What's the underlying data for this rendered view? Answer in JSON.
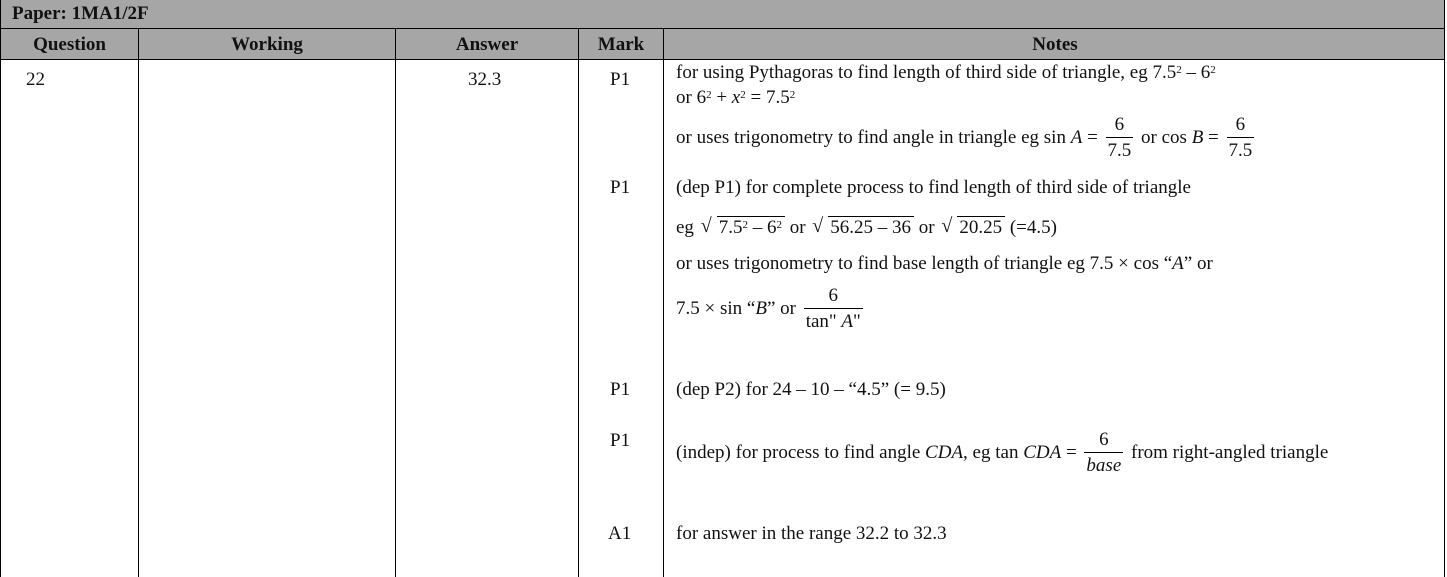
{
  "paper": {
    "title": "Paper: 1MA1/2F"
  },
  "headers": {
    "question": "Question",
    "working": "Working",
    "answer": "Answer",
    "mark": "Mark",
    "notes": "Notes"
  },
  "row": {
    "question": "22",
    "answer": "32.3"
  },
  "marks": [
    "P1",
    "P1",
    "P1",
    "P1",
    "A1"
  ],
  "notes": {
    "n1_a": "for using Pythagoras to find length of third side of triangle, eg  7.5",
    "n1_b": " – 6",
    "n1_c": "or 6",
    "n1_d": " + ",
    "n1_e": "x",
    "n1_f": " = 7.5",
    "sup2": "2",
    "n2_a": "or uses trigonometry to find angle in triangle eg sin ",
    "n2_A": "A",
    "n2_eq": " = ",
    "n2_num": "6",
    "n2_den": "7.5",
    "n2_or": " or cos ",
    "n2_B": "B",
    "n3": "(dep P1) for complete process to find length of third side of triangle",
    "n4_eg": "eg ",
    "n4_r1a": "7.5",
    "n4_r1b": " – 6",
    "n4_or1": "   or ",
    "n4_r2": "56.25 – 36",
    "n4_or2": "   or ",
    "n4_r3": "20.25",
    "n4_res": "  (=4.5)",
    "n5_a": "or uses trigonometry to find base length of triangle eg 7.5 × cos “",
    "n5_A": "A",
    "n5_b": "” or",
    "n6_a": "7.5 × sin “",
    "n6_B": "B",
    "n6_b": "” or ",
    "n6_num": "6",
    "n6_den_a": "tan\" ",
    "n6_den_A": "A",
    "n6_den_b": "\"",
    "n7": "(dep P2) for 24 –  10 – “4.5” (= 9.5)",
    "n8_a": "(indep) for process to find angle ",
    "n8_cda1": "CDA",
    "n8_b": ", eg tan ",
    "n8_cda2": "CDA",
    "n8_eq": " = ",
    "n8_num": "6",
    "n8_den": "base",
    "n8_c": " from right-angled triangle",
    "n9": "for answer in the range 32.2 to 32.3"
  }
}
